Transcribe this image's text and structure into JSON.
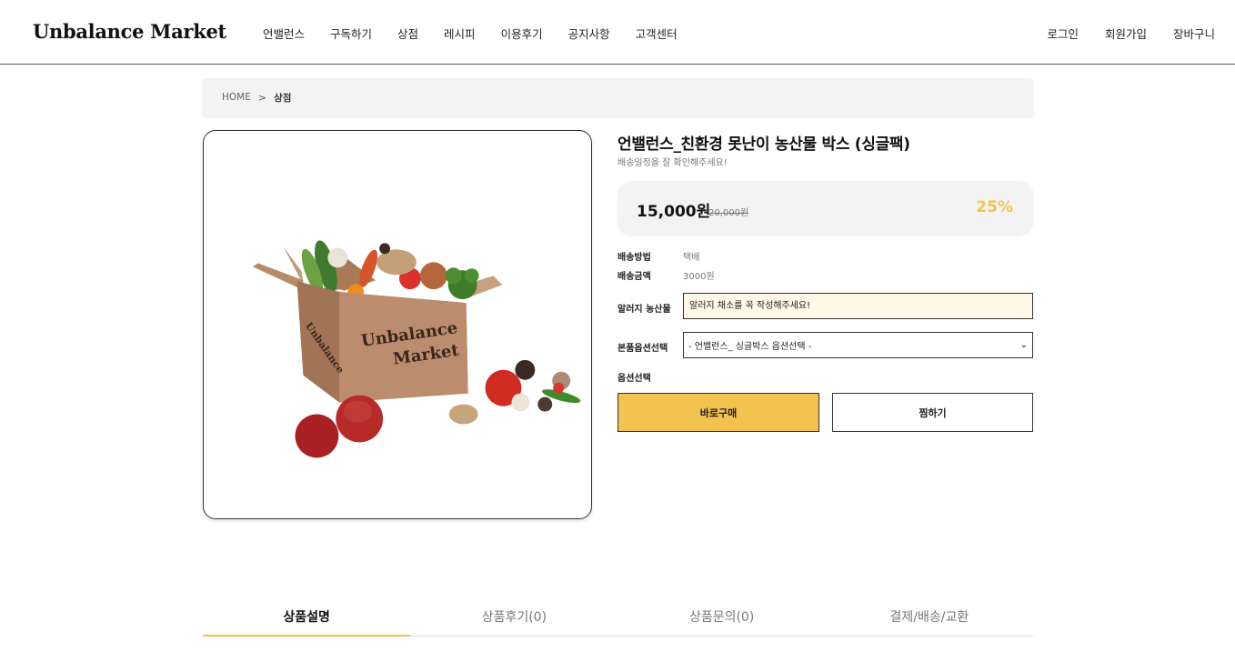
{
  "header": {
    "logo": "Unbalance Market",
    "nav": [
      "언밸런스",
      "구독하기",
      "상점",
      "레시피",
      "이용후기",
      "공지사항",
      "고객센터"
    ],
    "util": [
      "로그인",
      "회원가입",
      "장바구니"
    ]
  },
  "breadcrumb": {
    "home": "HOME",
    "separator": ">",
    "current": "상점"
  },
  "product": {
    "title": "언밸런스_친환경 못난이 농산물 박스 (싱글팩)",
    "subtitle": "배송일정을 잘 확인해주세요!",
    "price": "15,000원",
    "original_price": "20,000원",
    "discount": "25%",
    "box_text_line1": "Unbalance",
    "box_text_line2": "Market",
    "box_side_text": "Unbalance"
  },
  "shipping": {
    "method_label": "배송방법",
    "method_value": "택배",
    "fee_label": "배송금액",
    "fee_value": "3000원"
  },
  "form": {
    "allergy_label": "알러지 농산물",
    "allergy_placeholder": "알러지 채소를 꼭 작성해주세요!",
    "option_label": "본품옵션선택",
    "option_selected": "- 언밸런스_ 싱글박스 옵션선택 -",
    "option_select_label": "옵션선택"
  },
  "buttons": {
    "buy": "바로구매",
    "wish": "찜하기"
  },
  "tabs": [
    "상품설명",
    "상품후기(0)",
    "상품문의(0)",
    "결제/배송/교환"
  ],
  "colors": {
    "accent": "#f2c34e",
    "discount": "#f0c44c",
    "input_bg": "#fff8e6"
  }
}
